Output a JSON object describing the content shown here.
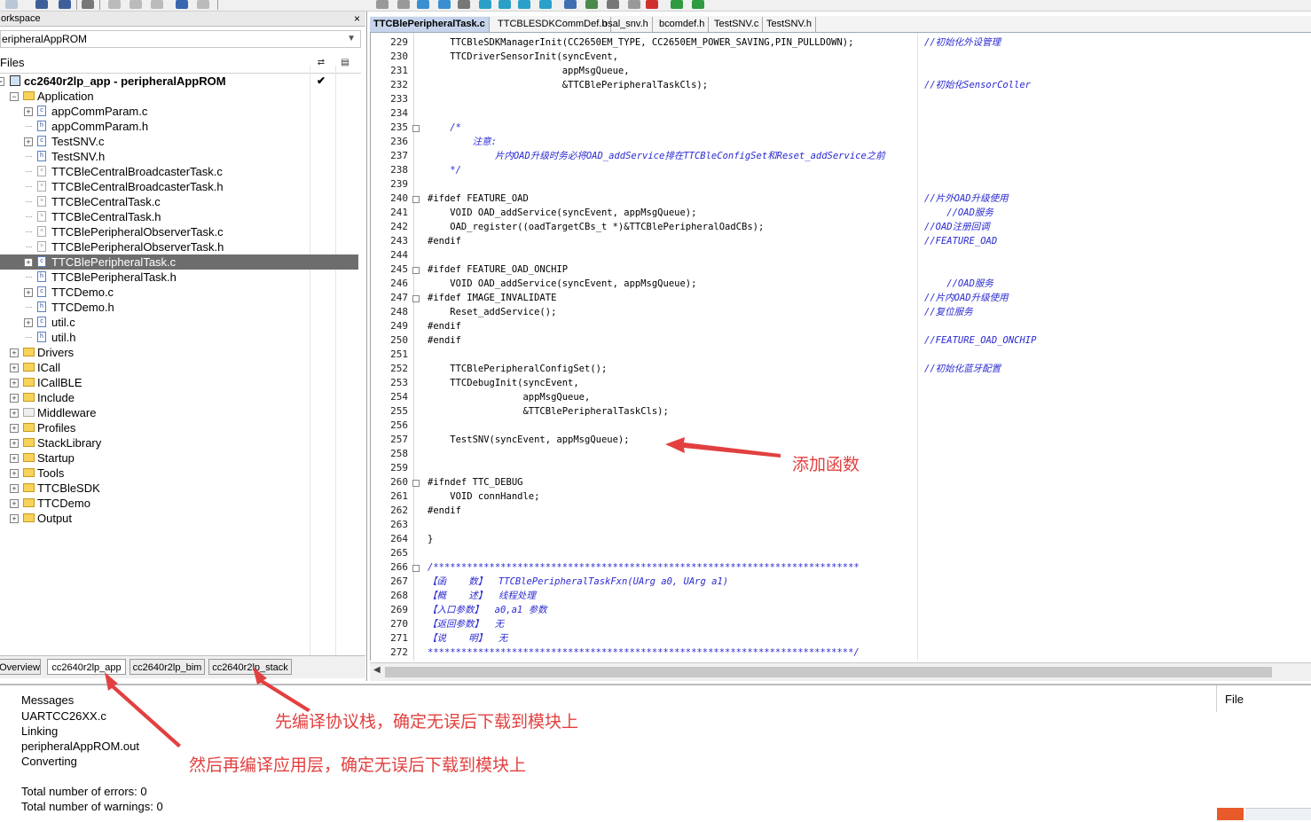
{
  "workspace": {
    "title": "orkspace",
    "close": "×",
    "config": "eripheralAppROM",
    "files_header": "Files",
    "project": "cc2640r2lp_app - peripheralAppROM",
    "tree": [
      {
        "label": "Application",
        "type": "folder",
        "expanded": true,
        "level": 1
      },
      {
        "label": "appCommParam.c",
        "type": "c",
        "level": 2,
        "expander": true
      },
      {
        "label": "appCommParam.h",
        "type": "h",
        "level": 2
      },
      {
        "label": "TestSNV.c",
        "type": "c",
        "level": 2,
        "expander": true
      },
      {
        "label": "TestSNV.h",
        "type": "h",
        "level": 2
      },
      {
        "label": "TTCBleCentralBroadcasterTask.c",
        "type": "x",
        "level": 2
      },
      {
        "label": "TTCBleCentralBroadcasterTask.h",
        "type": "x",
        "level": 2
      },
      {
        "label": "TTCBleCentralTask.c",
        "type": "x",
        "level": 2
      },
      {
        "label": "TTCBleCentralTask.h",
        "type": "x",
        "level": 2
      },
      {
        "label": "TTCBlePeripheralObserverTask.c",
        "type": "x",
        "level": 2
      },
      {
        "label": "TTCBlePeripheralObserverTask.h",
        "type": "x",
        "level": 2
      },
      {
        "label": "TTCBlePeripheralTask.c",
        "type": "c",
        "level": 2,
        "expander": true,
        "selected": true
      },
      {
        "label": "TTCBlePeripheralTask.h",
        "type": "h",
        "level": 2
      },
      {
        "label": "TTCDemo.c",
        "type": "c",
        "level": 2,
        "expander": true
      },
      {
        "label": "TTCDemo.h",
        "type": "h",
        "level": 2
      },
      {
        "label": "util.c",
        "type": "c",
        "level": 2,
        "expander": true
      },
      {
        "label": "util.h",
        "type": "h",
        "level": 2
      },
      {
        "label": "Drivers",
        "type": "folder",
        "level": 1
      },
      {
        "label": "ICall",
        "type": "folder",
        "level": 1
      },
      {
        "label": "ICallBLE",
        "type": "folder",
        "level": 1
      },
      {
        "label": "Include",
        "type": "folder",
        "level": 1
      },
      {
        "label": "Middleware",
        "type": "folderx",
        "level": 1
      },
      {
        "label": "Profiles",
        "type": "folder",
        "level": 1
      },
      {
        "label": "StackLibrary",
        "type": "folder",
        "level": 1
      },
      {
        "label": "Startup",
        "type": "folder",
        "level": 1
      },
      {
        "label": "Tools",
        "type": "folder",
        "level": 1
      },
      {
        "label": "TTCBleSDK",
        "type": "folder",
        "level": 1
      },
      {
        "label": "TTCDemo",
        "type": "folder",
        "level": 1
      },
      {
        "label": "Output",
        "type": "folder",
        "level": 1
      }
    ],
    "tabs": [
      "Overview",
      "cc2640r2lp_app",
      "cc2640r2lp_bim",
      "cc2640r2lp_stack"
    ]
  },
  "editor": {
    "tabs": [
      "TTCBlePeripheralTask.c",
      "TTCBLESDKCommDef.h",
      "osal_snv.h",
      "bcomdef.h",
      "TestSNV.c",
      "TestSNV.h"
    ],
    "lines": [
      {
        "n": "229",
        "code": "    TTCBleSDKManagerInit(CC2650EM_TYPE, CC2650EM_POWER_SAVING,PIN_PULLDOWN);",
        "cmt": "//初始化外设管理"
      },
      {
        "n": "230",
        "code": "    TTCDriverSensorInit(syncEvent,",
        "cmt": ""
      },
      {
        "n": "231",
        "code": "                        appMsgQueue,",
        "cmt": ""
      },
      {
        "n": "232",
        "code": "                        &TTCBlePeripheralTaskCls);",
        "cmt": "//初始化SensorColler"
      },
      {
        "n": "233",
        "code": "",
        "cmt": ""
      },
      {
        "n": "234",
        "code": "",
        "cmt": ""
      },
      {
        "n": "235",
        "code": "    /*",
        "cmt": "",
        "blue": true
      },
      {
        "n": "236",
        "code": "        注意:",
        "cmt": "",
        "blue": true
      },
      {
        "n": "237",
        "code": "            片内OAD升级时务必将OAD_addService排在TTCBleConfigSet和Reset_addService之前",
        "cmt": "",
        "blue": true
      },
      {
        "n": "238",
        "code": "    */",
        "cmt": "",
        "blue": true
      },
      {
        "n": "239",
        "code": "",
        "cmt": ""
      },
      {
        "n": "240",
        "code": "#ifdef FEATURE_OAD",
        "cmt": "//片外OAD升级使用"
      },
      {
        "n": "241",
        "code": "    VOID OAD_addService(syncEvent, appMsgQueue);",
        "cmt": "    //OAD服务"
      },
      {
        "n": "242",
        "code": "    OAD_register((oadTargetCBs_t *)&TTCBlePeripheralOadCBs);",
        "cmt": "//OAD注册回调"
      },
      {
        "n": "243",
        "code": "#endif",
        "cmt": "//FEATURE_OAD"
      },
      {
        "n": "244",
        "code": "",
        "cmt": ""
      },
      {
        "n": "245",
        "code": "#ifdef FEATURE_OAD_ONCHIP",
        "cmt": ""
      },
      {
        "n": "246",
        "code": "    VOID OAD_addService(syncEvent, appMsgQueue);",
        "cmt": "    //OAD服务"
      },
      {
        "n": "247",
        "code": "#ifdef IMAGE_INVALIDATE",
        "cmt": "//片内OAD升级使用"
      },
      {
        "n": "248",
        "code": "    Reset_addService();",
        "cmt": "//复位服务"
      },
      {
        "n": "249",
        "code": "#endif",
        "cmt": ""
      },
      {
        "n": "250",
        "code": "#endif",
        "cmt": "//FEATURE_OAD_ONCHIP"
      },
      {
        "n": "251",
        "code": "",
        "cmt": ""
      },
      {
        "n": "252",
        "code": "    TTCBlePeripheralConfigSet();",
        "cmt": "//初始化蓝牙配置"
      },
      {
        "n": "253",
        "code": "    TTCDebugInit(syncEvent,",
        "cmt": ""
      },
      {
        "n": "254",
        "code": "                 appMsgQueue,",
        "cmt": ""
      },
      {
        "n": "255",
        "code": "                 &TTCBlePeripheralTaskCls);",
        "cmt": ""
      },
      {
        "n": "256",
        "code": "",
        "cmt": ""
      },
      {
        "n": "257",
        "code": "    TestSNV(syncEvent, appMsgQueue);",
        "cmt": ""
      },
      {
        "n": "258",
        "code": "",
        "cmt": ""
      },
      {
        "n": "259",
        "code": "",
        "cmt": ""
      },
      {
        "n": "260",
        "code": "#ifndef TTC_DEBUG",
        "cmt": ""
      },
      {
        "n": "261",
        "code": "    VOID connHandle;",
        "cmt": ""
      },
      {
        "n": "262",
        "code": "#endif",
        "cmt": ""
      },
      {
        "n": "263",
        "code": "",
        "cmt": ""
      },
      {
        "n": "264",
        "code": "}",
        "cmt": ""
      },
      {
        "n": "265",
        "code": "",
        "cmt": ""
      },
      {
        "n": "266",
        "code": "/****************************************************************************",
        "cmt": "",
        "blue": true
      },
      {
        "n": "267",
        "code": "【函    数】  TTCBlePeripheralTaskFxn(UArg a0, UArg a1)",
        "cmt": "",
        "blue": true
      },
      {
        "n": "268",
        "code": "【概    述】  线程处理",
        "cmt": "",
        "blue": true
      },
      {
        "n": "269",
        "code": "【入口参数】  a0,a1 参数",
        "cmt": "",
        "blue": true
      },
      {
        "n": "270",
        "code": "【返回参数】  无",
        "cmt": "",
        "blue": true
      },
      {
        "n": "271",
        "code": "【说    明】  无",
        "cmt": "",
        "blue": true
      },
      {
        "n": "272",
        "code": "****************************************************************************/",
        "cmt": "",
        "blue": true
      }
    ]
  },
  "messages": {
    "header": "Messages",
    "file_header": "File",
    "lines": [
      "UARTCC26XX.c",
      "Linking",
      "peripheralAppROM.out",
      "Converting",
      "",
      "Total number of errors: 0",
      "Total number of warnings: 0"
    ]
  },
  "annotations": {
    "add_function": "添加函数",
    "compile_stack": "先编译协议栈，确定无误后下载到模块上",
    "compile_app": "然后再编译应用层，确定无误后下载到模块上"
  },
  "colors": {
    "annotation": "#e24040",
    "comment": "#2a2ad0",
    "selected_row": "#6d6d6d",
    "active_tab": "#c6d5ec"
  }
}
